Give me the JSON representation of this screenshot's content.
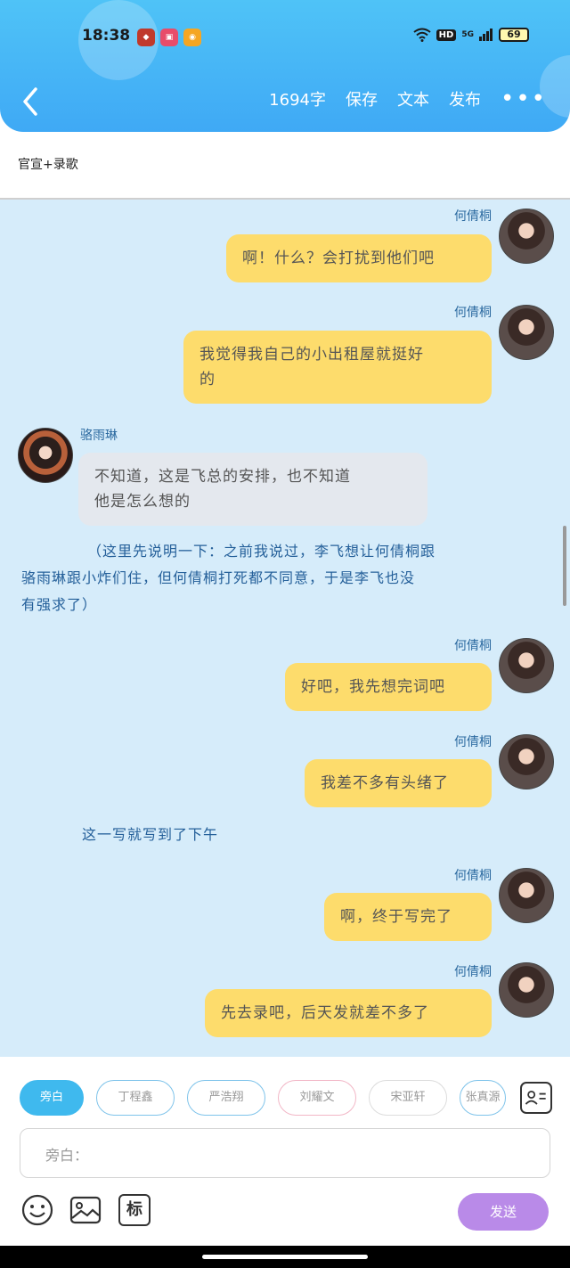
{
  "status_bar": {
    "time": "18:38",
    "battery": "69",
    "network": "5G",
    "hd": "HD"
  },
  "toolbar": {
    "word_count": "1694字",
    "save": "保存",
    "text": "文本",
    "publish": "发布"
  },
  "title": "官宣+录歌",
  "messages": [
    {
      "speaker": "何倩桐",
      "side": "right",
      "text": "啊！什么？会打扰到他们吧"
    },
    {
      "speaker": "何倩桐",
      "side": "right",
      "text_line1": "我觉得我自己的小出租屋就挺好",
      "text_line2": "的"
    },
    {
      "speaker": "骆雨琳",
      "side": "left",
      "text_line1": "不知道，这是飞总的安排，也不知道",
      "text_line2": "他是怎么想的"
    },
    {
      "type": "narration",
      "text_line1": "（这里先说明一下：之前我说过，李飞想让何倩桐跟",
      "text_line2": "骆雨琳跟小炸们住，但何倩桐打死都不同意，于是李飞也没",
      "text_line3": "有强求了）"
    },
    {
      "speaker": "何倩桐",
      "side": "right",
      "text": "好吧，我先想完词吧"
    },
    {
      "speaker": "何倩桐",
      "side": "right",
      "text": "我差不多有头绪了"
    },
    {
      "type": "narration",
      "text": "这一写就写到了下午"
    },
    {
      "speaker": "何倩桐",
      "side": "right",
      "text": "啊，终于写完了"
    },
    {
      "speaker": "何倩桐",
      "side": "right",
      "text": "先去录吧，后天发就差不多了"
    }
  ],
  "chips": [
    "旁白",
    "丁程鑫",
    "严浩翔",
    "刘耀文",
    "宋亚轩",
    "张真源"
  ],
  "input": {
    "placeholder": "旁白："
  },
  "send_label": "发送",
  "tool_label": "标",
  "colors": {
    "header": "#3fa9f5",
    "chat_bg": "#d6ecfa",
    "bubble_right": "#fddc6c",
    "bubble_left": "#e4e8ee",
    "send": "#b98ae8"
  }
}
